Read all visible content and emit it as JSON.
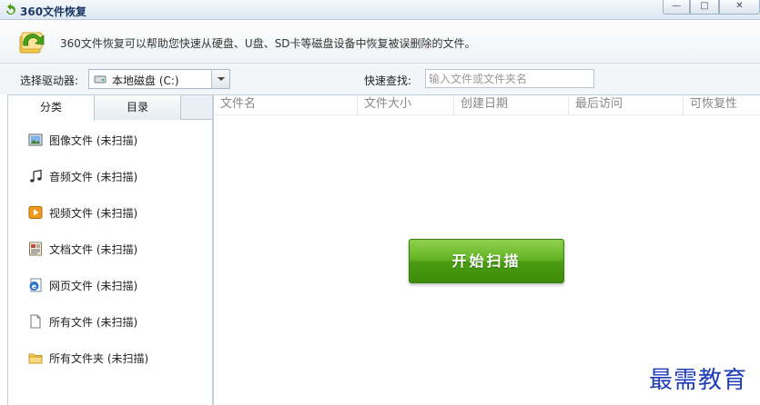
{
  "window": {
    "title": "360文件恢复",
    "minimize_label": "—",
    "maximize_label": "□",
    "close_label": "✕"
  },
  "banner": {
    "text": "360文件恢复可以帮助您快速从硬盘、U盘、SD卡等磁盘设备中恢复被误删除的文件。"
  },
  "toolbar": {
    "drive_label": "选择驱动器:",
    "drive_value": "本地磁盘 (C:)",
    "search_label": "快速查找:",
    "search_placeholder": "输入文件或文件夹名"
  },
  "tabs": [
    "分类",
    "目录"
  ],
  "categories": [
    {
      "label": "图像文件 (未扫描)",
      "icon": "image-icon"
    },
    {
      "label": "音频文件 (未扫描)",
      "icon": "music-note-icon"
    },
    {
      "label": "视频文件 (未扫描)",
      "icon": "video-icon"
    },
    {
      "label": "文档文件 (未扫描)",
      "icon": "document-icon"
    },
    {
      "label": "网页文件 (未扫描)",
      "icon": "web-page-icon"
    },
    {
      "label": "所有文件 (未扫描)",
      "icon": "blank-file-icon"
    },
    {
      "label": "所有文件夹 (未扫描)",
      "icon": "folder-icon"
    }
  ],
  "columns": [
    "文件名",
    "文件大小",
    "创建日期",
    "最后访问",
    "可恢复性"
  ],
  "scan_button": "开始扫描",
  "watermark": "最需教育"
}
